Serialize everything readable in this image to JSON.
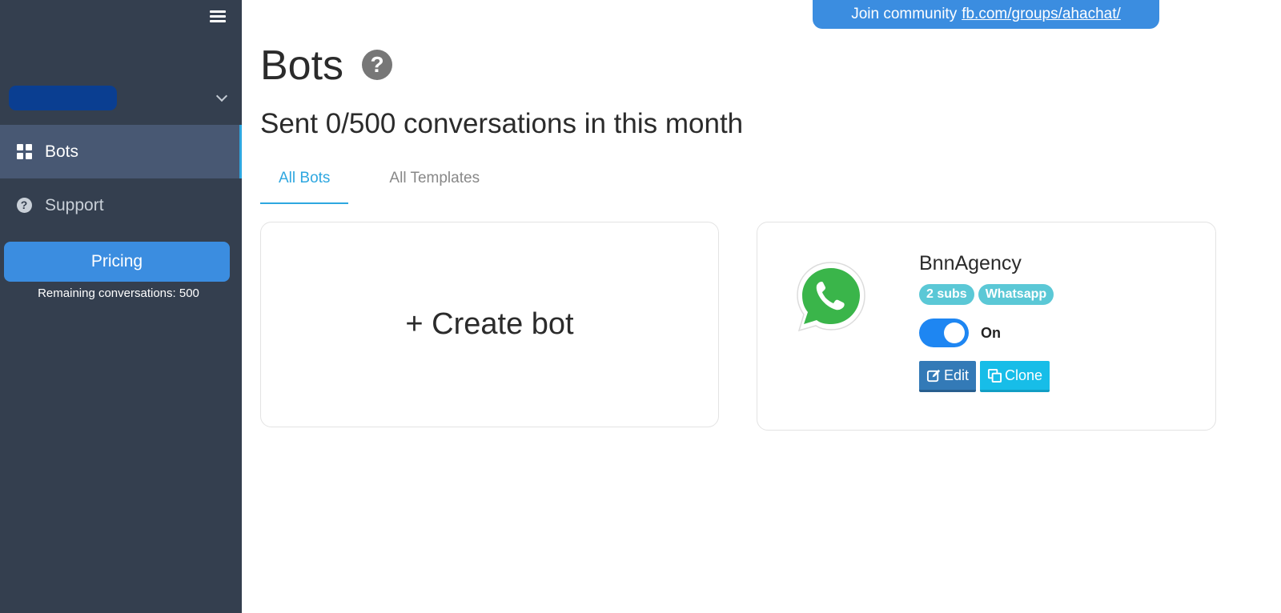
{
  "sidebar": {
    "menu_icon": "hamburger-menu-icon",
    "nav": [
      {
        "label": "Bots",
        "icon": "dashboard-grid-icon",
        "active": true
      },
      {
        "label": "Support",
        "icon": "question-circle-icon",
        "active": false
      }
    ],
    "pricing_label": "Pricing",
    "remaining_text": "Remaining conversations: 500"
  },
  "banner": {
    "prefix": "Join community",
    "link": "fb.com/groups/ahachat/"
  },
  "main": {
    "title": "Bots",
    "help_icon_glyph": "?",
    "sent_text": "Sent 0/500 conversations in this month",
    "tabs": [
      {
        "label": "All Bots",
        "active": true
      },
      {
        "label": "All Templates",
        "active": false
      }
    ],
    "create_label": "+ Create bot"
  },
  "bot": {
    "name": "BnnAgency",
    "platform_icon": "whatsapp-logo",
    "badges": [
      "2 subs",
      "Whatsapp"
    ],
    "toggle_state": "On",
    "edit_label": "Edit",
    "clone_label": "Clone"
  },
  "colors": {
    "sidebar_bg": "#343f4f",
    "accent_blue": "#3b8de0",
    "active_tab": "#2ea7e0",
    "badge": "#5bc8d6",
    "edit_button": "#337ab7",
    "clone_button": "#17bde8",
    "toggle_on": "#1e86f2"
  }
}
